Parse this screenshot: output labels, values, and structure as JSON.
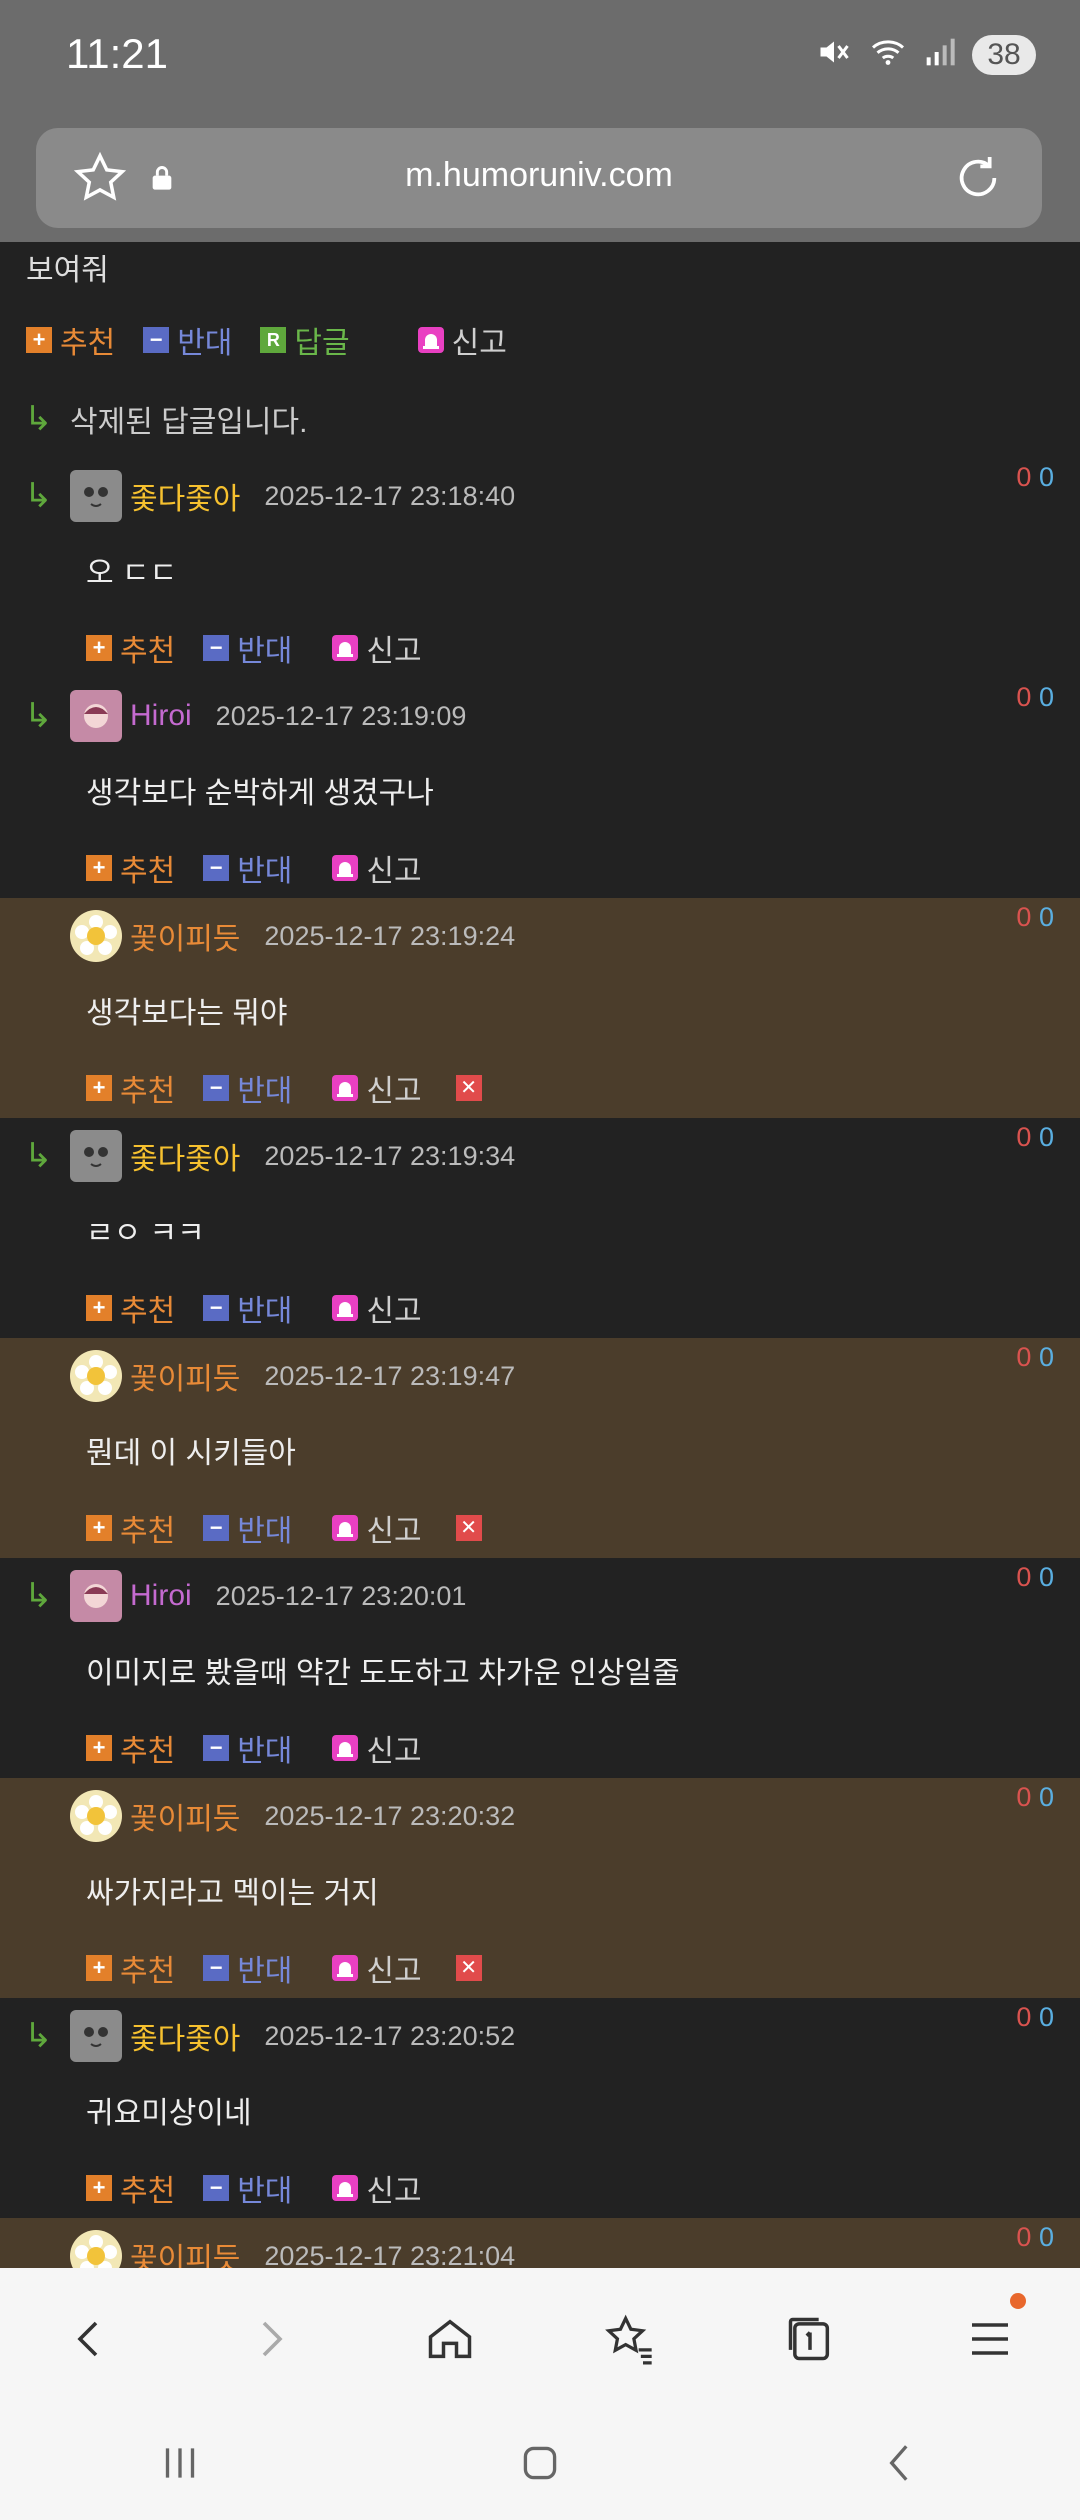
{
  "status": {
    "time": "11:21",
    "battery": "38"
  },
  "browser": {
    "url": "m.humoruniv.com"
  },
  "top": {
    "text": "보여줘",
    "actions": {
      "recommend": "추천",
      "oppose": "반대",
      "reply": "답글",
      "report": "신고"
    },
    "reply_icon": "R"
  },
  "deleted_text": "삭제된 답글입니다.",
  "labels": {
    "recommend": "추천",
    "oppose": "반대",
    "report": "신고"
  },
  "comments": [
    {
      "nick": "좇다좇아",
      "date": "2025-12-17 23:18:40",
      "text": "오 ㄷㄷ",
      "up": "0",
      "down": "0"
    },
    {
      "nick": "Hiroi",
      "date": "2025-12-17 23:19:09",
      "text": "생각보다 순박하게 생겼구나",
      "up": "0",
      "down": "0"
    },
    {
      "nick": "꽃이피듯",
      "date": "2025-12-17 23:19:24",
      "text": "생각보다는 뭐야",
      "up": "0",
      "down": "0"
    },
    {
      "nick": "좇다좇아",
      "date": "2025-12-17 23:19:34",
      "text": "ㄹㅇ ㅋㅋ",
      "up": "0",
      "down": "0"
    },
    {
      "nick": "꽃이피듯",
      "date": "2025-12-17 23:19:47",
      "text": "뭔데 이 시키들아",
      "up": "0",
      "down": "0"
    },
    {
      "nick": "Hiroi",
      "date": "2025-12-17 23:20:01",
      "text": "이미지로 봤을때 약간 도도하고 차가운 인상일줄",
      "up": "0",
      "down": "0"
    },
    {
      "nick": "꽃이피듯",
      "date": "2025-12-17 23:20:32",
      "text": "싸가지라고 멕이는 거지",
      "up": "0",
      "down": "0"
    },
    {
      "nick": "좇다좇아",
      "date": "2025-12-17 23:20:52",
      "text": "귀요미상이네",
      "up": "0",
      "down": "0"
    },
    {
      "nick": "꽃이피듯",
      "date": "2025-12-17 23:21:04",
      "text": "",
      "up": "0",
      "down": "0"
    }
  ]
}
